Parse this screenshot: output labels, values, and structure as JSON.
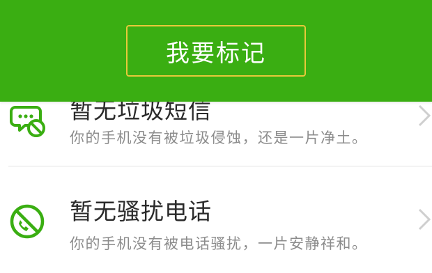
{
  "overlay": {
    "mark_button_label": "我要标记"
  },
  "list": {
    "items": [
      {
        "title": "暂无垃圾短信",
        "description": "你的手机没有被垃圾侵蚀，还是一片净土。",
        "icon": "sms-blocked-icon"
      },
      {
        "title": "暂无骚扰电话",
        "description": "你的手机没有被电话骚扰，一片安静祥和。",
        "icon": "call-blocked-icon"
      }
    ]
  },
  "colors": {
    "accent_green": "#3aae12",
    "button_border": "#e8c93a",
    "title_text": "#2a2a2a",
    "desc_text": "#8c8c8c"
  }
}
